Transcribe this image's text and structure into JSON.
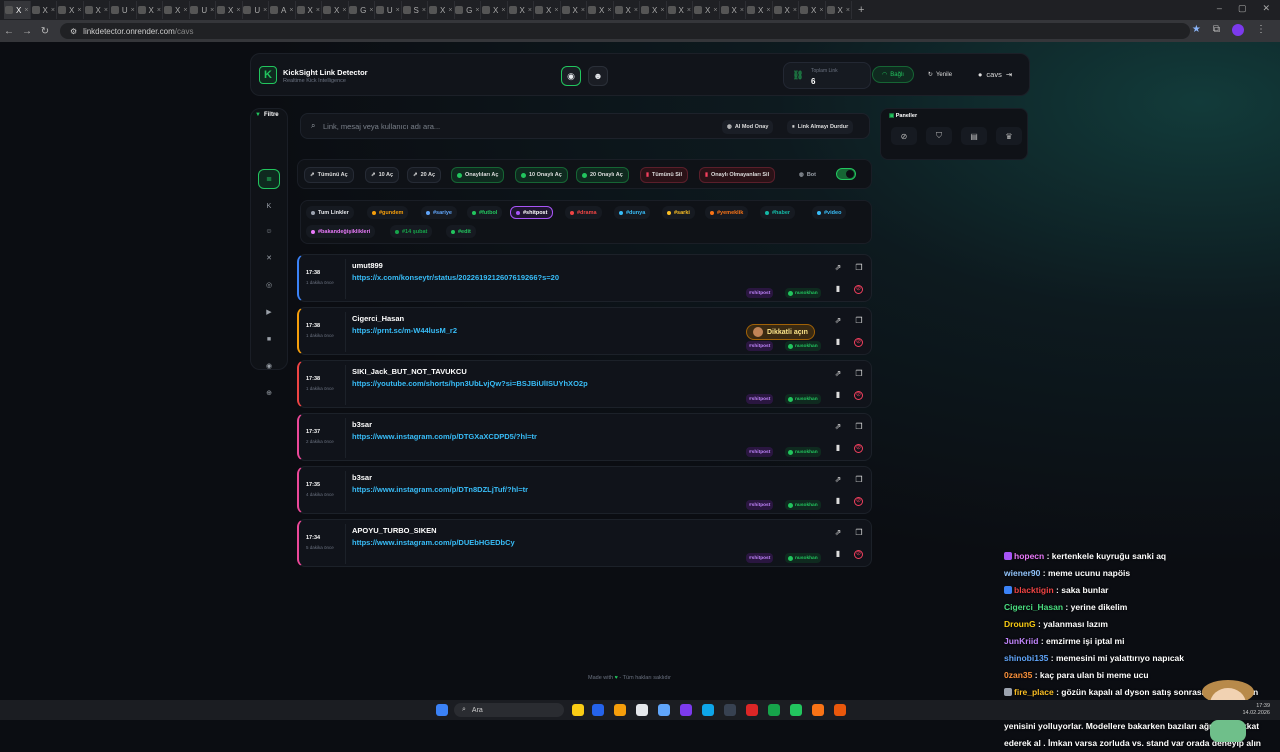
{
  "browser": {
    "tabs": [
      "X",
      "X",
      "X",
      "X",
      "U",
      "X",
      "X",
      "U",
      "X",
      "U",
      "A",
      "X",
      "X",
      "G",
      "U",
      "S",
      "X",
      "G",
      "X",
      "X",
      "X",
      "X",
      "X",
      "X",
      "X",
      "X",
      "X",
      "X",
      "X",
      "X",
      "X",
      "X"
    ],
    "new_tab": "+",
    "url_host": "linkdetector.onrender.com",
    "url_path": "/cavs"
  },
  "header": {
    "logo": "K",
    "title": "KickSight Link Detector",
    "subtitle": "Realtime Kick Intelligence",
    "stat_label": "Toplam Link",
    "stat_value": "6",
    "connected_label": "Bağlı",
    "refresh_label": "Yenile",
    "user_label": "cavs"
  },
  "sidebar": {
    "title": "Filtre",
    "items": [
      {
        "icon": "list-icon",
        "glyph": "≣"
      },
      {
        "icon": "kick-icon",
        "glyph": "K"
      },
      {
        "icon": "user-add-icon",
        "glyph": "☺"
      },
      {
        "icon": "x-icon",
        "glyph": "✕"
      },
      {
        "icon": "instagram-icon",
        "glyph": "◎"
      },
      {
        "icon": "youtube-icon",
        "glyph": "▶"
      },
      {
        "icon": "video-icon",
        "glyph": "■"
      },
      {
        "icon": "camera-icon",
        "glyph": "◉"
      },
      {
        "icon": "globe-icon",
        "glyph": "⊕"
      }
    ]
  },
  "search": {
    "placeholder": "Link, mesaj veya kullanıcı adı ara...",
    "ai_mod_label": "AI Mod Onay",
    "stop_label": "Link Almayı Durdur"
  },
  "actions": {
    "open_all": "Tümünü Aç",
    "open_10": "10 Aç",
    "open_20": "20 Aç",
    "open_approved": "Onaylıları Aç",
    "open_10_approved": "10 Onaylı Aç",
    "open_20_approved": "20 Onaylı Aç",
    "delete_all": "Tümünü Sil",
    "delete_unapproved": "Onaylı Olmayanları Sil",
    "bot": "Bot"
  },
  "tags": [
    {
      "label": "Tum Linkler",
      "color": "#9ca3af"
    },
    {
      "label": "#gundem",
      "color": "#f59e0b"
    },
    {
      "label": "#sariye",
      "color": "#60a5fa"
    },
    {
      "label": "#futbol",
      "color": "#22c55e"
    },
    {
      "label": "#shitpost",
      "color": "#a855f7"
    },
    {
      "label": "#drama",
      "color": "#ef4444"
    },
    {
      "label": "#dunya",
      "color": "#38bdf8"
    },
    {
      "label": "#sarki",
      "color": "#fbbf24"
    },
    {
      "label": "#yemeklik",
      "color": "#f97316"
    },
    {
      "label": "#haber",
      "color": "#14b8a6"
    },
    {
      "label": "#video",
      "color": "#38bdf8"
    },
    {
      "label": "#bakandeğişiklikleri",
      "color": "#e879f9"
    },
    {
      "label": "#14 şubat",
      "color": "#16a34a"
    },
    {
      "label": "#edit",
      "color": "#22c55e"
    }
  ],
  "links": [
    {
      "time": "17:38",
      "ago": "1 dakika önce",
      "user": "umut899",
      "url": "https://x.com/konseytr/status/2022619212607619266?s=20",
      "tag": "#shitpost",
      "chip": "nusokhan",
      "accent": "#3b82f6"
    },
    {
      "time": "17:38",
      "ago": "1 dakika önce",
      "user": "Cigerci_Hasan",
      "url": "https://prnt.sc/m-W44lusM_r2",
      "tag": "#shitpost",
      "chip": "nusokhan",
      "accent": "#f59e0b"
    },
    {
      "time": "17:38",
      "ago": "1 dakika önce",
      "user": "SIKI_Jack_BUT_NOT_TAVUKCU",
      "url": "https://youtube.com/shorts/hpn3UbLvjQw?si=BSJBiUlISUYhXO2p",
      "tag": "#shitpost",
      "chip": "nusokhan",
      "accent": "#ef4444"
    },
    {
      "time": "17:37",
      "ago": "2 dakika önce",
      "user": "b3sar",
      "url": "https://www.instagram.com/p/DTGXaXCDPD5/?hl=tr",
      "tag": "#shitpost",
      "chip": "nusokhan",
      "accent": "#ec4899"
    },
    {
      "time": "17:35",
      "ago": "4 dakika önce",
      "user": "b3sar",
      "url": "https://www.instagram.com/p/DTn8DZLjTuf/?hl=tr",
      "tag": "#shitpost",
      "chip": "nusokhan",
      "accent": "#ec4899"
    },
    {
      "time": "17:34",
      "ago": "5 dakika önce",
      "user": "APOYU_TURBO_SIKEN",
      "url": "https://www.instagram.com/p/DUEbHGEDbCy",
      "tag": "#shitpost",
      "chip": "nusokhan",
      "accent": "#ec4899"
    }
  ],
  "warning": {
    "label": "Dikkatli açın"
  },
  "panels": {
    "title": "Paneller",
    "icons": [
      "ban-icon",
      "shield-icon",
      "archive-icon",
      "trophy-icon"
    ]
  },
  "footer": {
    "text_before": "Made with",
    "text_after": "- Tüm hakları saklıdır"
  },
  "chat": [
    {
      "user": "hopecn",
      "user_color": "#e879f9",
      "msg": "kertenkele kuyruğu sanki aq",
      "badge": "#a855f7"
    },
    {
      "user": "wiener90",
      "user_color": "#93c5fd",
      "msg": "meme ucunu napöis",
      "badge": ""
    },
    {
      "user": "blacktigin",
      "user_color": "#ef4444",
      "msg": "saka bunlar",
      "badge": "#3b82f6"
    },
    {
      "user": "Cigerci_Hasan",
      "user_color": "#4ade80",
      "msg": "yerine dikelim",
      "badge": ""
    },
    {
      "user": "DrounG",
      "user_color": "#facc15",
      "msg": "yalanması lazım",
      "badge": ""
    },
    {
      "user": "JunKriid",
      "user_color": "#c084fc",
      "msg": "emzirme işi iptal mi",
      "badge": ""
    },
    {
      "user": "shinobi135",
      "user_color": "#60a5fa",
      "msg": "memesini mi yalattırıyo napıcak",
      "badge": ""
    },
    {
      "user": "0zan35",
      "user_color": "#fb923c",
      "msg": "kaç para ulan bi meme ucu",
      "badge": ""
    },
    {
      "user": "fire_place",
      "user_color": "#fbbf24",
      "msg": "gözün kapalı al dyson satış sonrası da ürününün sonuna kadar arkasında duruyor en alak sıkıntı çıktığında bi aloya yenisini yolluyorlar. Modellere bakarken bazıları ağır ona dikkat ederek al . İmkan varsa zorluda vs. stand var orada deneyip alın",
      "badge": "#9ca3af"
    }
  ],
  "taskbar": {
    "search": "Ara",
    "time": "17:39",
    "date": "14.02.2026"
  }
}
